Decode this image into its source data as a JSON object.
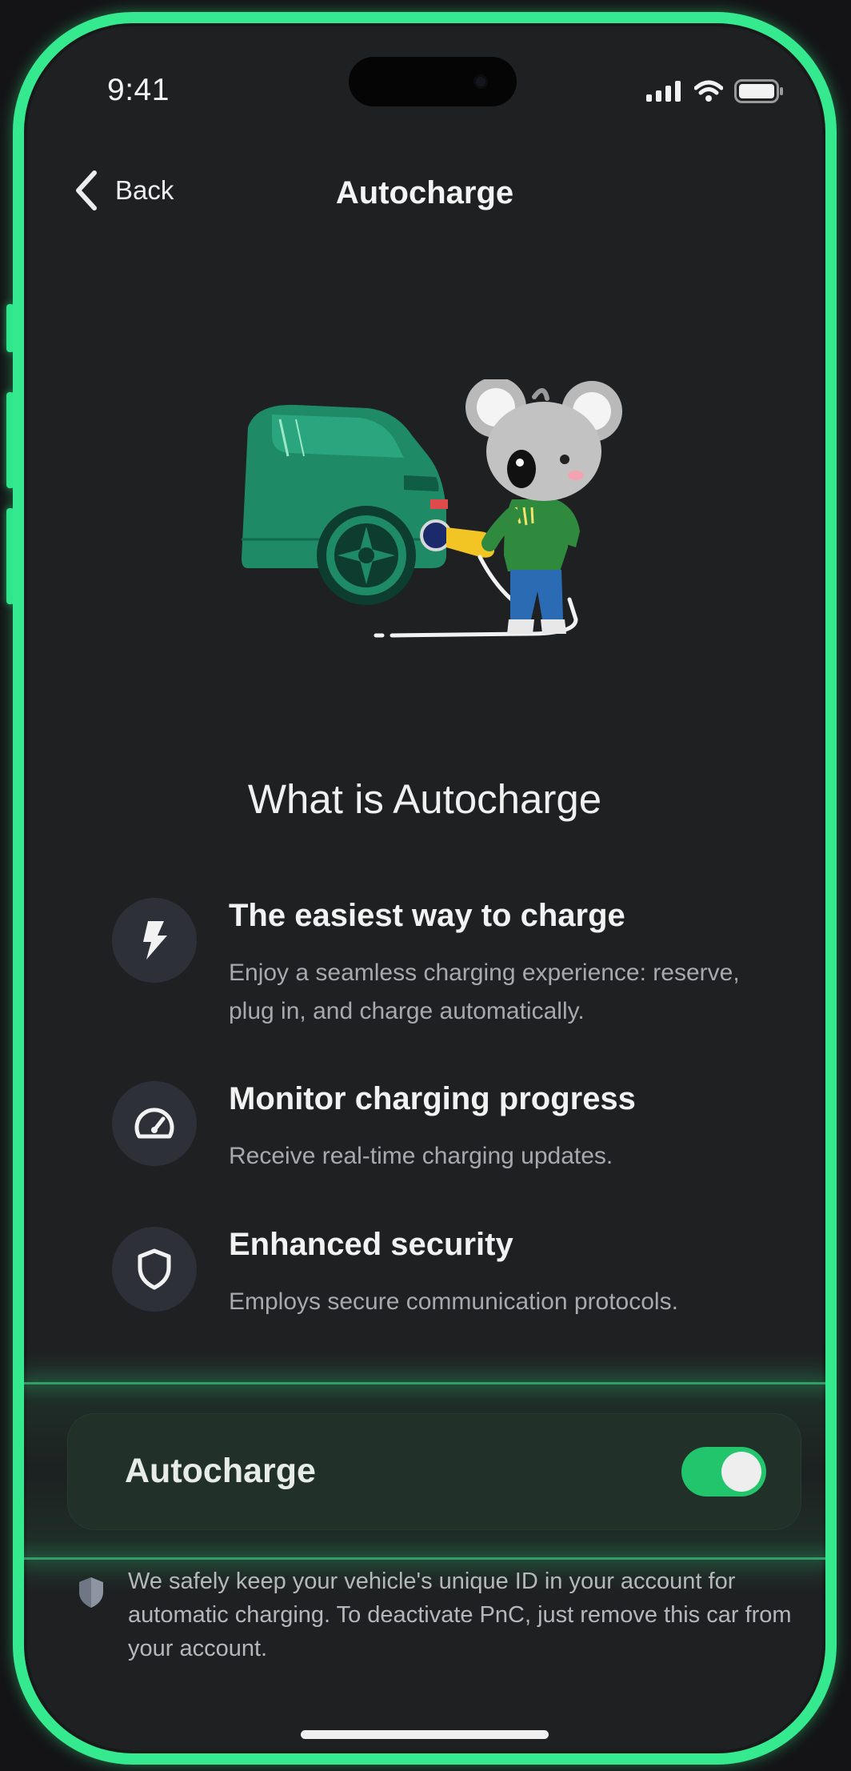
{
  "status_bar": {
    "time": "9:41"
  },
  "nav": {
    "back_label": "Back",
    "title": "Autocharge"
  },
  "content": {
    "headline": "What is Autocharge",
    "features": [
      {
        "icon": "bolt-icon",
        "title": "The easiest way to charge",
        "description": "Enjoy a seamless charging experience: reserve, plug in, and charge automatically."
      },
      {
        "icon": "speedometer-icon",
        "title": "Monitor charging progress",
        "description": "Receive real-time charging updates."
      },
      {
        "icon": "shield-icon",
        "title": "Enhanced security",
        "description": "Employs secure communication protocols."
      }
    ]
  },
  "toggle": {
    "label": "Autocharge",
    "enabled": true
  },
  "note": {
    "icon": "shield-fill-icon",
    "text": "We safely keep your vehicle's unique ID in your account for automatic charging. To deactivate PnC, just remove this car from your account."
  },
  "colors": {
    "frame_glow": "#35ea8e",
    "background": "#1f2022",
    "toggle_on": "#22c56b",
    "icon_circle": "#2d3137",
    "car_body": "#1e8a66",
    "charger_yellow": "#f2c524"
  }
}
